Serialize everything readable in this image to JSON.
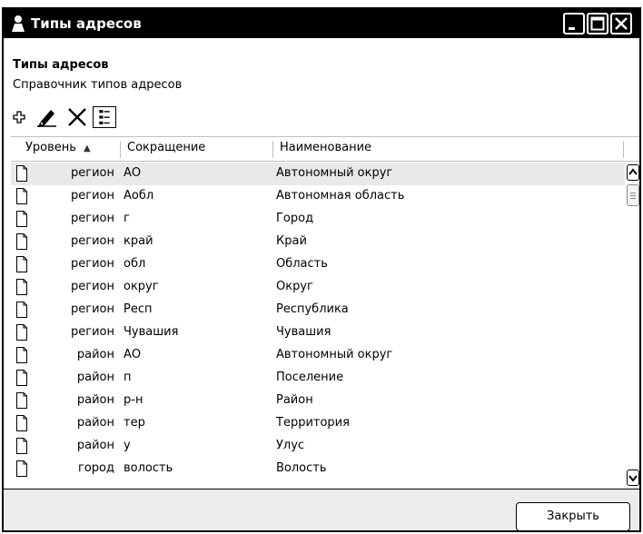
{
  "window": {
    "title": "Типы адресов",
    "buttons": {
      "minimize": "minimize",
      "maximize": "maximize",
      "close": "close"
    }
  },
  "header": {
    "title": "Типы адресов",
    "subtitle": "Справочник типов адресов"
  },
  "toolbar": {
    "icons": [
      "add-icon",
      "edit-pencil-icon",
      "delete-x-icon",
      "columns-icon"
    ]
  },
  "grid": {
    "columns": {
      "level": "Уровень",
      "abbreviation": "Сокращение",
      "name": "Наименование"
    },
    "sort": {
      "column": "level",
      "direction": "ascending"
    },
    "rows": [
      {
        "level": "регион",
        "abbr": "АО",
        "name": "Автономный округ"
      },
      {
        "level": "регион",
        "abbr": "Аобл",
        "name": "Автономная область"
      },
      {
        "level": "регион",
        "abbr": "г",
        "name": "Город"
      },
      {
        "level": "регион",
        "abbr": "край",
        "name": "Край"
      },
      {
        "level": "регион",
        "abbr": "обл",
        "name": "Область"
      },
      {
        "level": "регион",
        "abbr": "округ",
        "name": "Округ"
      },
      {
        "level": "регион",
        "abbr": "Респ",
        "name": "Республика"
      },
      {
        "level": "регион",
        "abbr": "Чувашия",
        "name": "Чувашия"
      },
      {
        "level": "район",
        "abbr": "АО",
        "name": "Автономный округ"
      },
      {
        "level": "район",
        "abbr": "п",
        "name": "Поселение"
      },
      {
        "level": "район",
        "abbr": "р-н",
        "name": "Район"
      },
      {
        "level": "район",
        "abbr": "тер",
        "name": "Территория"
      },
      {
        "level": "район",
        "abbr": "у",
        "name": "Улус"
      },
      {
        "level": "город",
        "abbr": "волость",
        "name": "Волость"
      }
    ],
    "selected_row": 0
  },
  "footer": {
    "close_label": "Закрыть"
  }
}
